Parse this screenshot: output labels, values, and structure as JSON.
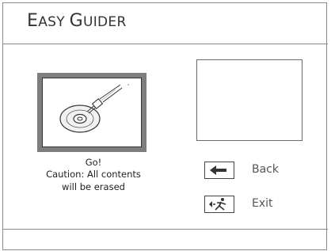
{
  "header": {
    "title_parts": [
      {
        "text": "E",
        "size": "cap"
      },
      {
        "text": "ASY ",
        "size": "sc"
      },
      {
        "text": "G",
        "size": "cap"
      },
      {
        "text": "UIDER",
        "size": "sc"
      }
    ]
  },
  "caption": {
    "line1": "Go!",
    "line2": "Caution: All contents",
    "line3": "will be erased"
  },
  "actions": {
    "back": {
      "label": "Back",
      "icon": "arrow-left-icon"
    },
    "exit": {
      "label": "Exit",
      "icon": "exit-running-man-icon"
    }
  },
  "thumbnail": {
    "icon": "disc-burn-icon"
  },
  "colors": {
    "frame": "#8a8a8a",
    "thumb_border": "#7e7e7e",
    "text": "#222222"
  }
}
